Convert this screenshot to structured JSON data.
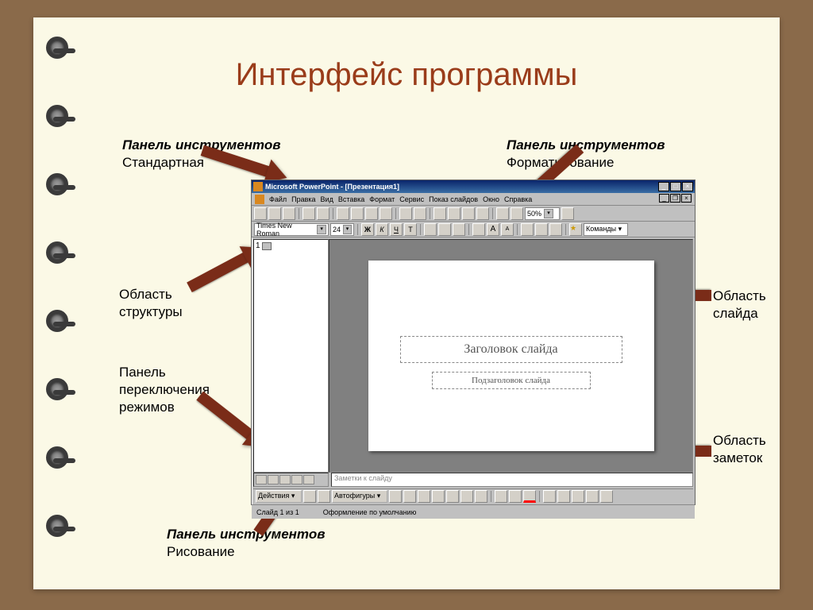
{
  "slide_title": "Интерфейс программы",
  "labels": {
    "std_toolbar_italic": "Панель инструментов",
    "std_toolbar_name": "Стандартная",
    "fmt_toolbar_italic": "Панель инструментов",
    "fmt_toolbar_name": "Форматирование",
    "outline_area": "Область структуры",
    "view_switch": "Панель переключения режимов",
    "draw_toolbar_italic": "Панель инструментов",
    "draw_toolbar_name": "Рисование",
    "slide_area": "Область слайда",
    "notes_area": "Область заметок"
  },
  "pp": {
    "title": "Microsoft PowerPoint - [Презентация1]",
    "menu": [
      "Файл",
      "Правка",
      "Вид",
      "Вставка",
      "Формат",
      "Сервис",
      "Показ слайдов",
      "Окно",
      "Справка"
    ],
    "font": "Times New Roman",
    "font_size": "24",
    "zoom": "50%",
    "commands": "Команды ▾",
    "outline_num": "1",
    "slide_title_ph": "Заголовок слайда",
    "slide_sub_ph": "Подзаголовок слайда",
    "notes_ph": "Заметки к слайду",
    "draw_actions": "Действия ▾",
    "autoshapes": "Автофигуры ▾",
    "status_slide": "Слайд 1 из 1",
    "status_layout": "Оформление по умолчанию"
  }
}
